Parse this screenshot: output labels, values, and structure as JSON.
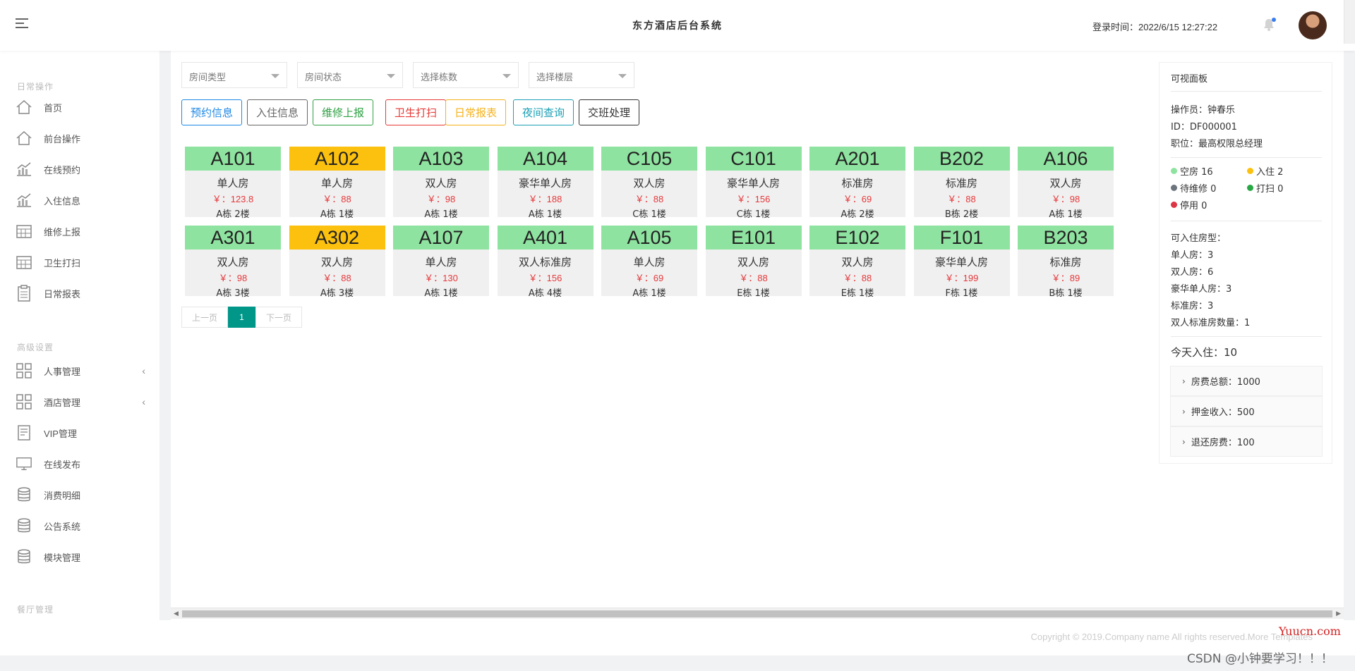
{
  "header": {
    "title": "东方酒店后台系统",
    "login_time": "登录时间：2022/6/15 12:27:22"
  },
  "sidebar": {
    "groups": [
      "日常操作",
      "高级设置",
      "餐厅管理"
    ],
    "items": [
      {
        "label": "首页",
        "icon": "home-icon"
      },
      {
        "label": "前台操作",
        "icon": "home-icon"
      },
      {
        "label": "在线预约",
        "icon": "chart-icon"
      },
      {
        "label": "入住信息",
        "icon": "chart-icon"
      },
      {
        "label": "维修上报",
        "icon": "calendar-icon"
      },
      {
        "label": "卫生打扫",
        "icon": "calendar-icon"
      },
      {
        "label": "日常报表",
        "icon": "clipboard-icon"
      },
      {
        "label": "人事管理",
        "icon": "grid-icon"
      },
      {
        "label": "酒店管理",
        "icon": "grid-icon"
      },
      {
        "label": "VIP管理",
        "icon": "document-icon"
      },
      {
        "label": "在线发布",
        "icon": "monitor-icon"
      },
      {
        "label": "消费明细",
        "icon": "database-icon"
      },
      {
        "label": "公告系统",
        "icon": "database-icon"
      },
      {
        "label": "模块管理",
        "icon": "database-icon"
      }
    ]
  },
  "filters": [
    "房间类型",
    "房间状态",
    "选择栋数",
    "选择楼层"
  ],
  "actions": [
    {
      "label": "预约信息",
      "color": "#1e88e5"
    },
    {
      "label": "入住信息",
      "color": "#666666"
    },
    {
      "label": "维修上报",
      "color": "#2ea043"
    },
    {
      "label": "卫生打扫",
      "color": "#e53935"
    },
    {
      "label": "日常报表",
      "color": "#f5b21b"
    },
    {
      "label": "夜间查询",
      "color": "#1a9fb5"
    },
    {
      "label": "交班处理",
      "color": "#333333"
    }
  ],
  "colors": {
    "vacant": "#8fe3a0",
    "occupied": "#fcc10e",
    "repair": "#6c757d",
    "cleaning": "#28a745",
    "disabled": "#dc3545"
  },
  "rooms": [
    {
      "no": "A101",
      "type": "单人房",
      "price": "￥：123.8",
      "building": "A栋 2楼",
      "status": "vacant"
    },
    {
      "no": "A102",
      "type": "单人房",
      "price": "￥：88",
      "building": "A栋 1楼",
      "status": "occupied"
    },
    {
      "no": "A103",
      "type": "双人房",
      "price": "￥：98",
      "building": "A栋 1楼",
      "status": "vacant"
    },
    {
      "no": "A104",
      "type": "豪华单人房",
      "price": "￥：188",
      "building": "A栋 1楼",
      "status": "vacant"
    },
    {
      "no": "C105",
      "type": "双人房",
      "price": "￥：88",
      "building": "C栋 1楼",
      "status": "vacant"
    },
    {
      "no": "C101",
      "type": "豪华单人房",
      "price": "￥：156",
      "building": "C栋 1楼",
      "status": "vacant"
    },
    {
      "no": "A201",
      "type": "标准房",
      "price": "￥：69",
      "building": "A栋 2楼",
      "status": "vacant"
    },
    {
      "no": "B202",
      "type": "标准房",
      "price": "￥：88",
      "building": "B栋 2楼",
      "status": "vacant"
    },
    {
      "no": "A106",
      "type": "双人房",
      "price": "￥：98",
      "building": "A栋 1楼",
      "status": "vacant"
    },
    {
      "no": "A301",
      "type": "双人房",
      "price": "￥：98",
      "building": "A栋 3楼",
      "status": "vacant"
    },
    {
      "no": "A302",
      "type": "双人房",
      "price": "￥：88",
      "building": "A栋 3楼",
      "status": "occupied"
    },
    {
      "no": "A107",
      "type": "单人房",
      "price": "￥：130",
      "building": "A栋 1楼",
      "status": "vacant"
    },
    {
      "no": "A401",
      "type": "双人标准房",
      "price": "￥：156",
      "building": "A栋 4楼",
      "status": "vacant"
    },
    {
      "no": "A105",
      "type": "单人房",
      "price": "￥：69",
      "building": "A栋 1楼",
      "status": "vacant"
    },
    {
      "no": "E101",
      "type": "双人房",
      "price": "￥：88",
      "building": "E栋 1楼",
      "status": "vacant"
    },
    {
      "no": "E102",
      "type": "双人房",
      "price": "￥：88",
      "building": "E栋 1楼",
      "status": "vacant"
    },
    {
      "no": "F101",
      "type": "豪华单人房",
      "price": "￥：199",
      "building": "F栋 1楼",
      "status": "vacant"
    },
    {
      "no": "B203",
      "type": "标准房",
      "price": "￥：89",
      "building": "B栋 1楼",
      "status": "vacant"
    }
  ],
  "pager": {
    "prev": "上一页",
    "current": "1",
    "next": "下一页"
  },
  "panel": {
    "title": "可视面板",
    "operator": "操作员：钟春乐",
    "id": "ID：DF000001",
    "position": "职位：最高权限总经理",
    "legend": [
      {
        "label": "空房 16",
        "color": "#8fe3a0"
      },
      {
        "label": "入住 2",
        "color": "#fcc10e"
      },
      {
        "label": "待维修 0",
        "color": "#6c757d"
      },
      {
        "label": "打扫 0",
        "color": "#28a745"
      },
      {
        "label": "停用 0",
        "color": "#dc3545"
      }
    ],
    "room_types_title": "可入住房型：",
    "room_types": [
      "单人房：3",
      "双人房：6",
      "豪华单人房：3",
      "标准房：3",
      "双人标准房数量：1"
    ],
    "today": "今天入住：10",
    "accordion": [
      "房费总额：1000",
      "押金收入：500",
      "退还房费：100"
    ]
  },
  "footer": {
    "copyright": "Copyright © 2019.Company name All rights reserved.More Templates",
    "watermark_site": "Yuucn.com",
    "watermark_csdn": "CSDN @小钟要学习！！！"
  }
}
